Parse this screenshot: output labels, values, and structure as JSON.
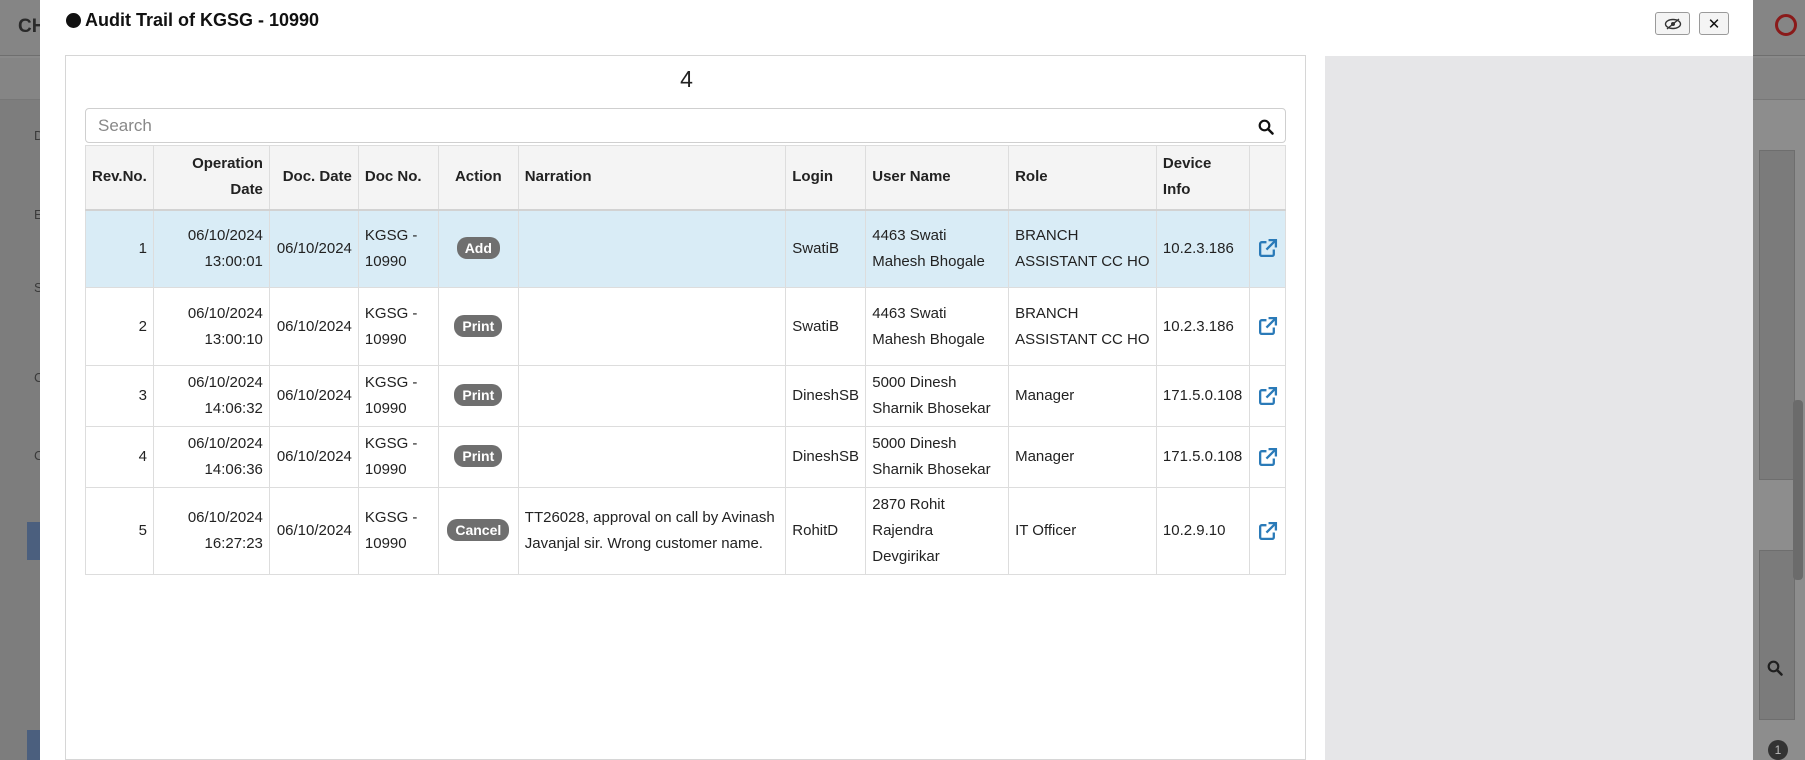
{
  "background": {
    "app_title": "CH",
    "side_letters": [
      "D",
      "E",
      "S",
      "C",
      "C"
    ]
  },
  "modal": {
    "title": "Audit Trail of KGSG - 10990",
    "close_label": "✕"
  },
  "record_count": "4",
  "search": {
    "placeholder": "Search",
    "value": ""
  },
  "table": {
    "columns": [
      "Rev.No.",
      "Operation Date",
      "Doc. Date",
      "Doc No.",
      "Action",
      "Narration",
      "Login",
      "User Name",
      "Role",
      "Device Info"
    ],
    "rows": [
      {
        "rev": "1",
        "op_date": "06/10/2024",
        "op_time": "13:00:01",
        "doc_date": "06/10/2024",
        "doc_no_a": "KGSG -",
        "doc_no_b": "10990",
        "action": "Add",
        "narration": "",
        "login": "SwatiB",
        "user_name": "4463 Swati Mahesh Bhogale",
        "role": "BRANCH ASSISTANT CC HO",
        "device": "10.2.3.186"
      },
      {
        "rev": "2",
        "op_date": "06/10/2024",
        "op_time": "13:00:10",
        "doc_date": "06/10/2024",
        "doc_no_a": "KGSG -",
        "doc_no_b": "10990",
        "action": "Print",
        "narration": "",
        "login": "SwatiB",
        "user_name": "4463 Swati Mahesh Bhogale",
        "role": "BRANCH ASSISTANT CC HO",
        "device": "10.2.3.186"
      },
      {
        "rev": "3",
        "op_date": "06/10/2024",
        "op_time": "14:06:32",
        "doc_date": "06/10/2024",
        "doc_no_a": "KGSG -",
        "doc_no_b": "10990",
        "action": "Print",
        "narration": "",
        "login": "DineshSB",
        "user_name": "5000 Dinesh Sharnik Bhosekar",
        "role": "Manager",
        "device": "171.5.0.108"
      },
      {
        "rev": "4",
        "op_date": "06/10/2024",
        "op_time": "14:06:36",
        "doc_date": "06/10/2024",
        "doc_no_a": "KGSG -",
        "doc_no_b": "10990",
        "action": "Print",
        "narration": "",
        "login": "DineshSB",
        "user_name": "5000 Dinesh Sharnik Bhosekar",
        "role": "Manager",
        "device": "171.5.0.108"
      },
      {
        "rev": "5",
        "op_date": "06/10/2024",
        "op_time": "16:27:23",
        "doc_date": "06/10/2024",
        "doc_no_a": "KGSG -",
        "doc_no_b": "10990",
        "action": "Cancel",
        "narration": "TT26028, approval on call by Avinash Javanjal sir. Wrong customer name.",
        "login": "RohitD",
        "user_name": "2870 Rohit Rajendra Devgirikar",
        "role": "IT Officer",
        "device": "10.2.9.10"
      }
    ]
  },
  "colors": {
    "highlight_row": "#d9ecf6",
    "badge": "#6f6f6f",
    "link_icon": "#2a7ab8",
    "right_panel": "#e6e6e8"
  },
  "icons": {
    "search": "search-icon",
    "row_link": "external-link-icon",
    "eye": "eye-slash-icon",
    "close": "close-icon"
  }
}
